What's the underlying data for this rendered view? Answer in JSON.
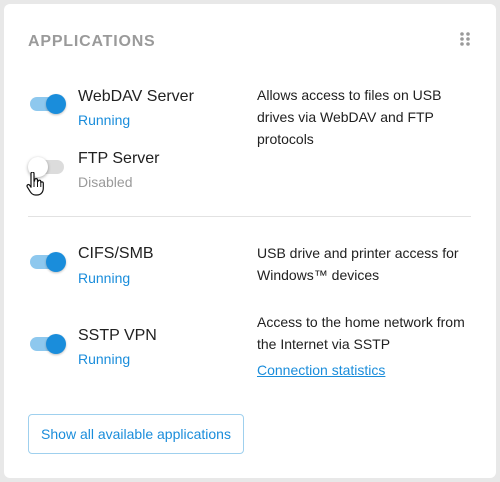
{
  "card": {
    "title": "APPLICATIONS",
    "drag_icon": "drag-dots-icon"
  },
  "apps": [
    {
      "name": "WebDAV Server",
      "status": "Running",
      "enabled": true
    },
    {
      "name": "FTP Server",
      "status": "Disabled",
      "enabled": false
    },
    {
      "name": "CIFS/SMB",
      "status": "Running",
      "enabled": true
    },
    {
      "name": "SSTP VPN",
      "status": "Running",
      "enabled": true
    }
  ],
  "descriptions": {
    "webdav_ftp": "Allows access to files on USB drives via WebDAV and FTP protocols",
    "cifs": "USB drive and printer access for Windows™ devices",
    "sstp": "Access to the home network from the Internet via SSTP"
  },
  "links": {
    "connection_statistics": "Connection statistics"
  },
  "buttons": {
    "show_all": "Show all available applications"
  },
  "colors": {
    "accent": "#1a8ddb",
    "toggle_track_on": "#8ec8ee",
    "muted_text": "#9a9a9a",
    "card_bg": "#ffffff",
    "page_bg": "#e8e8e8"
  }
}
